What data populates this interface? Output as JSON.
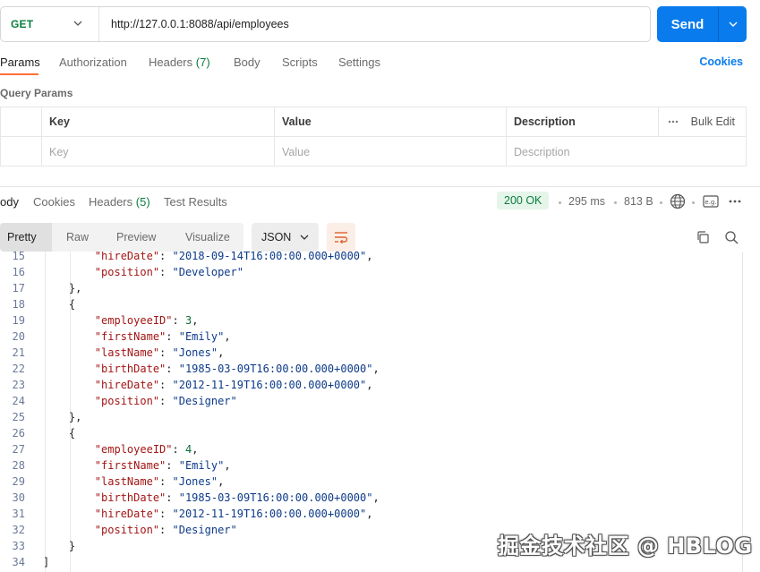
{
  "request": {
    "method": "GET",
    "url": "http://127.0.0.1:8088/api/employees",
    "send_label": "Send"
  },
  "request_tabs": {
    "params": "Params",
    "authorization": "Authorization",
    "headers": "Headers",
    "headers_count": "(7)",
    "body": "Body",
    "scripts": "Scripts",
    "settings": "Settings",
    "cookies": "Cookies"
  },
  "query_params": {
    "title": "Query Params",
    "col_key": "Key",
    "col_value": "Value",
    "col_description": "Description",
    "bulk_edit": "Bulk Edit",
    "key_placeholder": "Key",
    "value_placeholder": "Value",
    "description_placeholder": "Description"
  },
  "response_tabs": {
    "body": "ody",
    "cookies": "Cookies",
    "headers": "Headers",
    "headers_count": "(5)",
    "test_results": "Test Results"
  },
  "response_meta": {
    "status": "200 OK",
    "time": "295 ms",
    "size": "813 B"
  },
  "view": {
    "pretty": "Pretty",
    "raw": "Raw",
    "preview": "Preview",
    "visualize": "Visualize",
    "format": "JSON"
  },
  "code_lines": [
    {
      "n": "15",
      "tokens": [
        {
          "t": "        ",
          "c": "p"
        },
        {
          "t": "\"hireDate\"",
          "c": "k"
        },
        {
          "t": ": ",
          "c": "p"
        },
        {
          "t": "\"2018-09-14T16:00:00.000+0000\"",
          "c": "s"
        },
        {
          "t": ",",
          "c": "p"
        }
      ]
    },
    {
      "n": "16",
      "tokens": [
        {
          "t": "        ",
          "c": "p"
        },
        {
          "t": "\"position\"",
          "c": "k"
        },
        {
          "t": ": ",
          "c": "p"
        },
        {
          "t": "\"Developer\"",
          "c": "s"
        }
      ]
    },
    {
      "n": "17",
      "tokens": [
        {
          "t": "    },",
          "c": "p"
        }
      ]
    },
    {
      "n": "18",
      "tokens": [
        {
          "t": "    {",
          "c": "p"
        }
      ]
    },
    {
      "n": "19",
      "tokens": [
        {
          "t": "        ",
          "c": "p"
        },
        {
          "t": "\"employeeID\"",
          "c": "k"
        },
        {
          "t": ": ",
          "c": "p"
        },
        {
          "t": "3",
          "c": "n"
        },
        {
          "t": ",",
          "c": "p"
        }
      ]
    },
    {
      "n": "20",
      "tokens": [
        {
          "t": "        ",
          "c": "p"
        },
        {
          "t": "\"firstName\"",
          "c": "k"
        },
        {
          "t": ": ",
          "c": "p"
        },
        {
          "t": "\"Emily\"",
          "c": "s"
        },
        {
          "t": ",",
          "c": "p"
        }
      ]
    },
    {
      "n": "21",
      "tokens": [
        {
          "t": "        ",
          "c": "p"
        },
        {
          "t": "\"lastName\"",
          "c": "k"
        },
        {
          "t": ": ",
          "c": "p"
        },
        {
          "t": "\"Jones\"",
          "c": "s"
        },
        {
          "t": ",",
          "c": "p"
        }
      ]
    },
    {
      "n": "22",
      "tokens": [
        {
          "t": "        ",
          "c": "p"
        },
        {
          "t": "\"birthDate\"",
          "c": "k"
        },
        {
          "t": ": ",
          "c": "p"
        },
        {
          "t": "\"1985-03-09T16:00:00.000+0000\"",
          "c": "s"
        },
        {
          "t": ",",
          "c": "p"
        }
      ]
    },
    {
      "n": "23",
      "tokens": [
        {
          "t": "        ",
          "c": "p"
        },
        {
          "t": "\"hireDate\"",
          "c": "k"
        },
        {
          "t": ": ",
          "c": "p"
        },
        {
          "t": "\"2012-11-19T16:00:00.000+0000\"",
          "c": "s"
        },
        {
          "t": ",",
          "c": "p"
        }
      ]
    },
    {
      "n": "24",
      "tokens": [
        {
          "t": "        ",
          "c": "p"
        },
        {
          "t": "\"position\"",
          "c": "k"
        },
        {
          "t": ": ",
          "c": "p"
        },
        {
          "t": "\"Designer\"",
          "c": "s"
        }
      ]
    },
    {
      "n": "25",
      "tokens": [
        {
          "t": "    },",
          "c": "p"
        }
      ]
    },
    {
      "n": "26",
      "tokens": [
        {
          "t": "    {",
          "c": "p"
        }
      ]
    },
    {
      "n": "27",
      "tokens": [
        {
          "t": "        ",
          "c": "p"
        },
        {
          "t": "\"employeeID\"",
          "c": "k"
        },
        {
          "t": ": ",
          "c": "p"
        },
        {
          "t": "4",
          "c": "n"
        },
        {
          "t": ",",
          "c": "p"
        }
      ]
    },
    {
      "n": "28",
      "tokens": [
        {
          "t": "        ",
          "c": "p"
        },
        {
          "t": "\"firstName\"",
          "c": "k"
        },
        {
          "t": ": ",
          "c": "p"
        },
        {
          "t": "\"Emily\"",
          "c": "s"
        },
        {
          "t": ",",
          "c": "p"
        }
      ]
    },
    {
      "n": "29",
      "tokens": [
        {
          "t": "        ",
          "c": "p"
        },
        {
          "t": "\"lastName\"",
          "c": "k"
        },
        {
          "t": ": ",
          "c": "p"
        },
        {
          "t": "\"Jones\"",
          "c": "s"
        },
        {
          "t": ",",
          "c": "p"
        }
      ]
    },
    {
      "n": "30",
      "tokens": [
        {
          "t": "        ",
          "c": "p"
        },
        {
          "t": "\"birthDate\"",
          "c": "k"
        },
        {
          "t": ": ",
          "c": "p"
        },
        {
          "t": "\"1985-03-09T16:00:00.000+0000\"",
          "c": "s"
        },
        {
          "t": ",",
          "c": "p"
        }
      ]
    },
    {
      "n": "31",
      "tokens": [
        {
          "t": "        ",
          "c": "p"
        },
        {
          "t": "\"hireDate\"",
          "c": "k"
        },
        {
          "t": ": ",
          "c": "p"
        },
        {
          "t": "\"2012-11-19T16:00:00.000+0000\"",
          "c": "s"
        },
        {
          "t": ",",
          "c": "p"
        }
      ]
    },
    {
      "n": "32",
      "tokens": [
        {
          "t": "        ",
          "c": "p"
        },
        {
          "t": "\"position\"",
          "c": "k"
        },
        {
          "t": ": ",
          "c": "p"
        },
        {
          "t": "\"Designer\"",
          "c": "s"
        }
      ]
    },
    {
      "n": "33",
      "tokens": [
        {
          "t": "    }",
          "c": "p"
        }
      ]
    },
    {
      "n": "34",
      "tokens": [
        {
          "t": "]",
          "c": "p"
        }
      ]
    }
  ],
  "watermark": "掘金技术社区 @ HBLOG",
  "colors": {
    "send_button": "#097bed",
    "method_get": "#0a7d3e",
    "active_tab_underline": "#ff6c37",
    "status_ok": "#0a7d3e"
  }
}
